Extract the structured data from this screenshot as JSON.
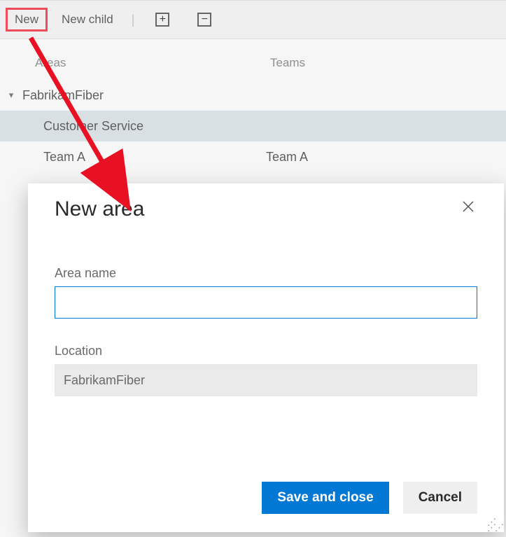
{
  "toolbar": {
    "new_label": "New",
    "new_child_label": "New child"
  },
  "columns": {
    "areas_label": "Areas",
    "teams_label": "Teams"
  },
  "tree": {
    "root": {
      "label": "FabrikamFiber",
      "team": ""
    },
    "children": [
      {
        "label": "Customer Service",
        "team": ""
      },
      {
        "label": "Team A",
        "team": "Team A"
      }
    ]
  },
  "dialog": {
    "title": "New area",
    "area_name_label": "Area name",
    "area_name_value": "",
    "location_label": "Location",
    "location_value": "FabrikamFiber",
    "save_label": "Save and close",
    "cancel_label": "Cancel"
  }
}
